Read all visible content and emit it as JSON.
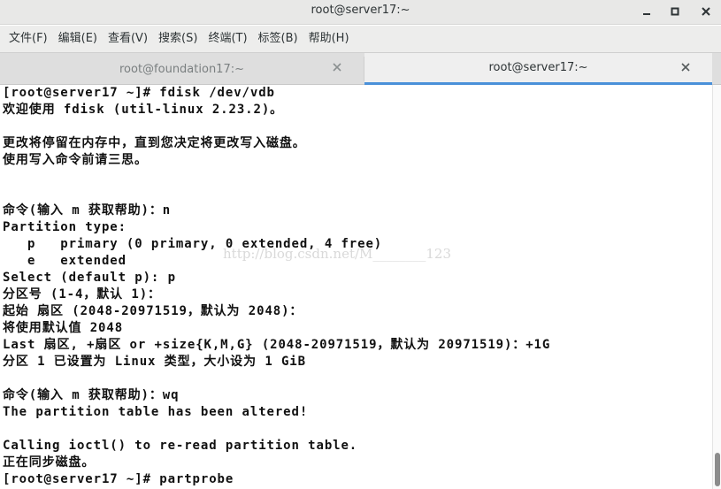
{
  "window": {
    "title": "root@server17:~"
  },
  "menubar": {
    "items": [
      "文件(F)",
      "编辑(E)",
      "查看(V)",
      "搜索(S)",
      "终端(T)",
      "标签(B)",
      "帮助(H)"
    ]
  },
  "tabs": [
    {
      "label": "root@foundation17:~",
      "active": false
    },
    {
      "label": "root@server17:~",
      "active": true
    }
  ],
  "terminal": {
    "lines": [
      "[root@server17 ~]# fdisk /dev/vdb",
      "欢迎使用 fdisk (util-linux 2.23.2)。",
      "",
      "更改将停留在内存中，直到您决定将更改写入磁盘。",
      "使用写入命令前请三思。",
      "",
      "",
      "命令(输入 m 获取帮助)：n",
      "Partition type:",
      "   p   primary (0 primary, 0 extended, 4 free)",
      "   e   extended",
      "Select (default p): p",
      "分区号 (1-4，默认 1)：",
      "起始 扇区 (2048-20971519，默认为 2048)：",
      "将使用默认值 2048",
      "Last 扇区, +扇区 or +size{K,M,G} (2048-20971519，默认为 20971519)：+1G",
      "分区 1 已设置为 Linux 类型，大小设为 1 GiB",
      "",
      "命令(输入 m 获取帮助)：wq",
      "The partition table has been altered!",
      "",
      "Calling ioctl() to re-read partition table.",
      "正在同步磁盘。",
      "[root@server17 ~]# partprobe"
    ],
    "watermark": "http://blog.csdn.net/M________123"
  },
  "colors": {
    "active_tab_underline": "#4a90d9",
    "terminal_text": "#111111",
    "terminal_background": "#ffffff"
  },
  "icons": {
    "minimize": "minimize-icon",
    "maximize": "maximize-icon",
    "close": "close-icon",
    "tab_close": "tab-close-icon"
  }
}
